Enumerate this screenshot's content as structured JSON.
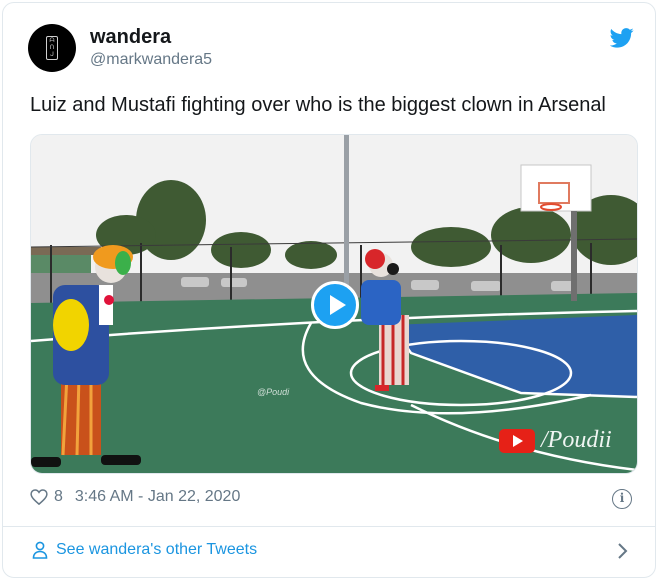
{
  "tweet": {
    "author_name": "wandera",
    "author_handle": "@markwandera5",
    "avatar_glyphs": "ᗩᑎᒍ",
    "text": "Luiz and Mustafi fighting over who is the biggest clown in Arsenal",
    "likes": "8",
    "timestamp": "3:46 AM - Jan 22, 2020"
  },
  "media": {
    "watermark_small": "@Poudi",
    "watermark_brand": "/Poudii"
  },
  "footer": {
    "see_more_label": "See wandera's other Tweets"
  },
  "icons": {
    "bird": "twitter-bird-icon",
    "play": "play-icon",
    "heart": "heart-icon",
    "info": "info-icon",
    "person": "person-icon",
    "chevron": "chevron-right-icon"
  },
  "colors": {
    "brand_blue": "#1da1f2",
    "link_blue": "#1b95e0",
    "secondary_text": "#657786",
    "border": "#e1e8ed",
    "court_green": "#3c7a5a",
    "court_blue": "#2f5fa8"
  }
}
